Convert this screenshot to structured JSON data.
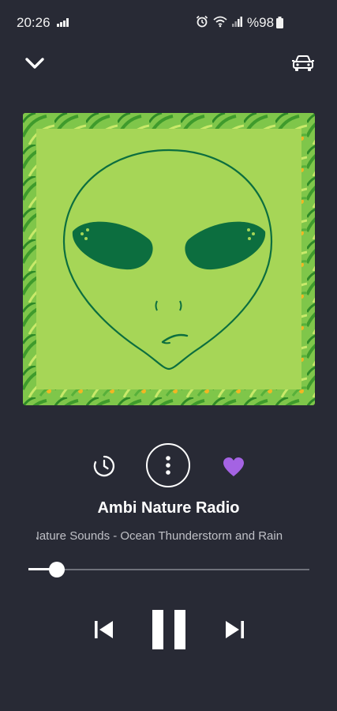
{
  "status_bar": {
    "time": "20:26",
    "battery": "%98",
    "icons": [
      "signal-icon",
      "alarm-icon",
      "wifi-icon",
      "signal-icon",
      "battery-icon"
    ]
  },
  "top_bar": {
    "collapse_icon": "chevron-down-icon",
    "car_mode_icon": "car-icon"
  },
  "now_playing": {
    "station": "Ambi Nature Radio",
    "track": "Nature Sounds - Ocean Thunderstorm and Rain",
    "artwork_icon": "alien-face-artwork",
    "progress": 0.1
  },
  "actions": {
    "sleep_timer_icon": "timer-icon",
    "more_icon": "more-vertical-icon",
    "favorite_icon": "heart-icon",
    "favorite_color": "#a463e3"
  },
  "controls": {
    "previous_icon": "skip-previous-icon",
    "pause_icon": "pause-icon",
    "next_icon": "skip-next-icon"
  },
  "colors": {
    "background": "#282a35",
    "artwork_green": "#a6d657",
    "alien_dark": "#0c6e3f"
  }
}
